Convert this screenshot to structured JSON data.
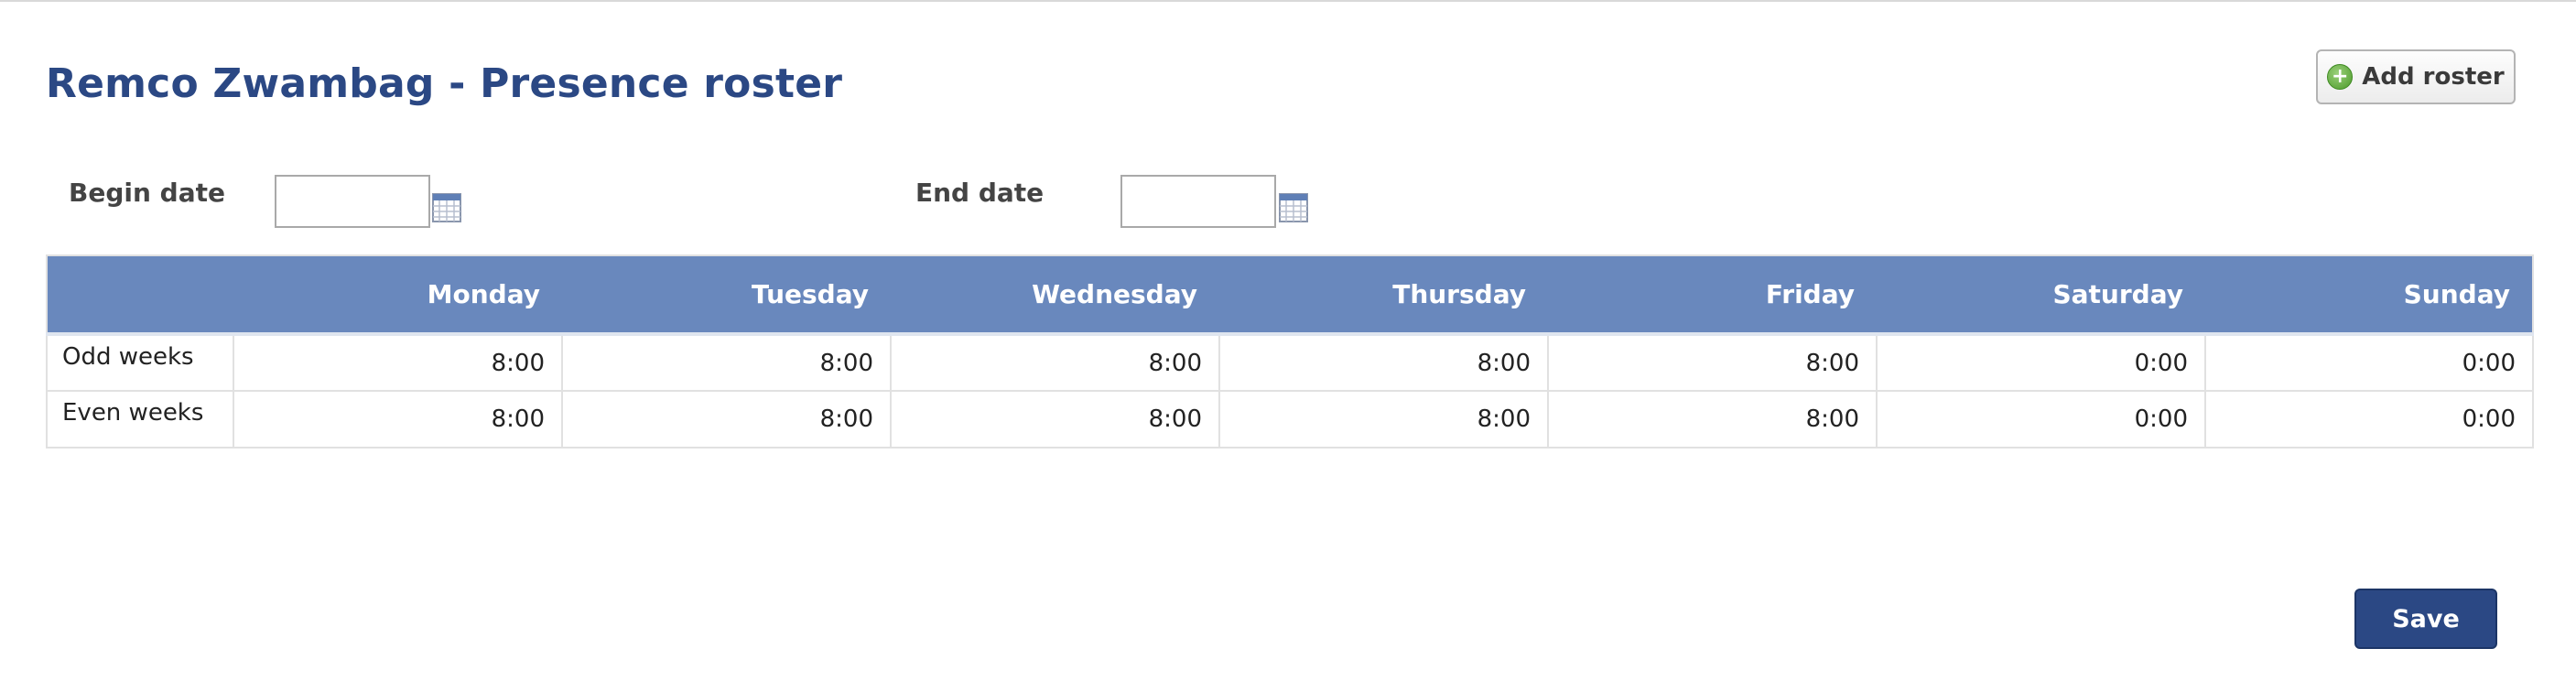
{
  "page": {
    "title": "Remco Zwambag - Presence roster",
    "add_roster_label": "Add roster",
    "save_label": "Save"
  },
  "filters": {
    "begin_date": {
      "label": "Begin date",
      "value": ""
    },
    "end_date": {
      "label": "End date",
      "value": ""
    }
  },
  "roster": {
    "days": [
      "Monday",
      "Tuesday",
      "Wednesday",
      "Thursday",
      "Friday",
      "Saturday",
      "Sunday"
    ],
    "rows": [
      {
        "label": "Odd weeks",
        "hours": [
          "8:00",
          "8:00",
          "8:00",
          "8:00",
          "8:00",
          "0:00",
          "0:00"
        ]
      },
      {
        "label": "Even weeks",
        "hours": [
          "8:00",
          "8:00",
          "8:00",
          "8:00",
          "8:00",
          "0:00",
          "0:00"
        ]
      }
    ]
  },
  "colors": {
    "title": "#2b4884",
    "table_header": "#6988bd",
    "save_button": "#2b4884",
    "plus_icon": "#4c9a2a"
  },
  "icons": {
    "add": "plus-circle-icon",
    "calendar": "calendar-icon"
  }
}
